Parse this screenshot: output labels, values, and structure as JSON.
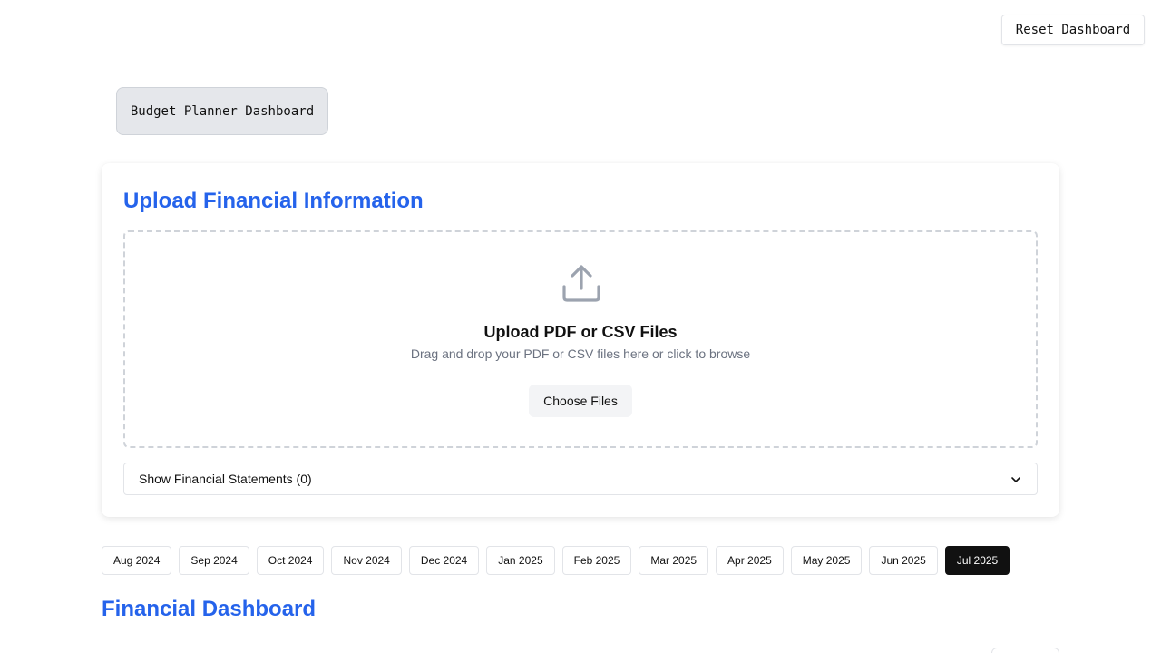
{
  "header": {
    "reset_label": "Reset Dashboard",
    "app_title": "Budget Planner Dashboard"
  },
  "upload": {
    "section_title": "Upload Financial Information",
    "dropzone_title": "Upload PDF or CSV Files",
    "dropzone_hint": "Drag and drop your PDF or CSV files here or click to browse",
    "choose_label": "Choose Files",
    "statements_label": "Show Financial Statements (0)"
  },
  "months": {
    "items": [
      "Aug 2024",
      "Sep 2024",
      "Oct 2024",
      "Nov 2024",
      "Dec 2024",
      "Jan 2025",
      "Feb 2025",
      "Mar 2025",
      "Apr 2025",
      "May 2025",
      "Jun 2025",
      "Jul 2025"
    ],
    "selected": "Jul 2025"
  },
  "dashboard": {
    "title": "Financial Dashboard"
  },
  "icons": {
    "upload": "upload-icon",
    "chevron": "chevron-down-icon"
  },
  "colors": {
    "accent": "#2563eb",
    "selected_month_bg": "#111111",
    "muted_text": "#6b7280"
  }
}
